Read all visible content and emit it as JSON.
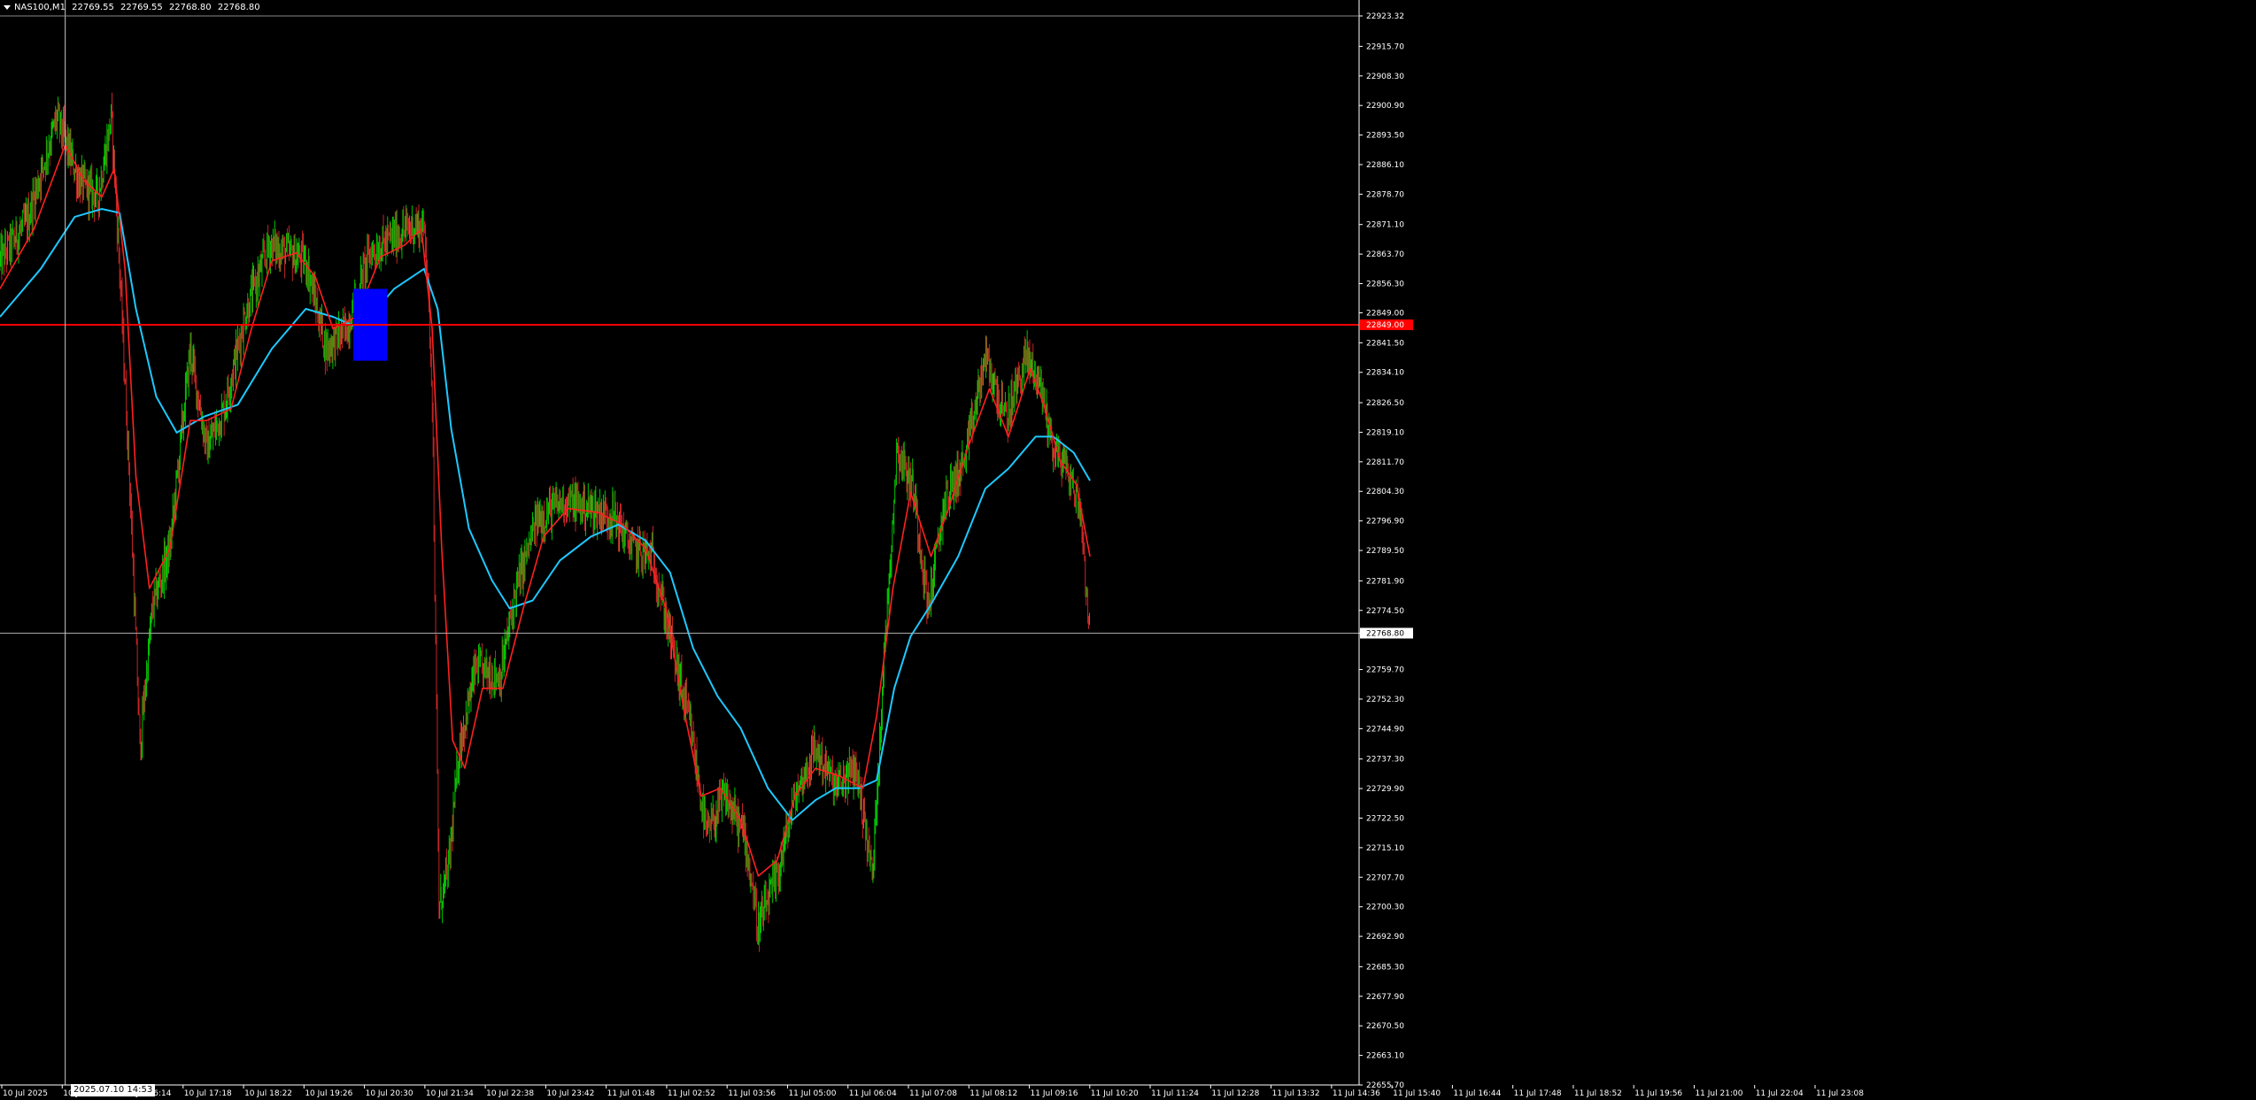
{
  "header": {
    "symbol": "NAS100,M1",
    "prices": [
      "22769.55",
      "22769.55",
      "22768.80",
      "22768.80"
    ]
  },
  "crosshair": {
    "time_label": "2025.07.10 14:53"
  },
  "colors": {
    "background": "#000000",
    "candle_up": "#00ff00",
    "candle_down": "#ff3030",
    "ma_fast": "#ff2020",
    "ma_slow": "#1ec8ff",
    "hline": "#ff0000",
    "box": "#0000ff",
    "axis_text": "#ffffff"
  },
  "icons": [
    "dropdown-triangle-icon"
  ],
  "chart_data": {
    "type": "line",
    "title": "NAS100,M1",
    "x_tick_labels": [
      "10 Jul 2025",
      "10 Jul 15:10",
      "10 Jul 16:14",
      "10 Jul 17:18",
      "10 Jul 18:22",
      "10 Jul 19:26",
      "10 Jul 20:30",
      "10 Jul 21:34",
      "10 Jul 22:38",
      "10 Jul 23:42",
      "11 Jul 01:48",
      "11 Jul 02:52",
      "11 Jul 03:56",
      "11 Jul 05:00",
      "11 Jul 06:04",
      "11 Jul 07:08",
      "11 Jul 08:12",
      "11 Jul 09:16",
      "11 Jul 10:20",
      "11 Jul 11:24",
      "11 Jul 12:28",
      "11 Jul 13:32",
      "11 Jul 14:36",
      "11 Jul 15:40",
      "11 Jul 16:44",
      "11 Jul 17:48",
      "11 Jul 18:52",
      "11 Jul 19:56",
      "11 Jul 21:00",
      "11 Jul 22:04",
      "11 Jul 23:08"
    ],
    "y_tick_labels": [
      "22923.32",
      "22915.70",
      "22908.30",
      "22900.90",
      "22893.50",
      "22886.10",
      "22878.70",
      "22871.10",
      "22863.70",
      "22856.30",
      "22849.00",
      "22841.50",
      "22834.10",
      "22826.50",
      "22819.10",
      "22811.70",
      "22804.30",
      "22796.90",
      "22789.50",
      "22781.90",
      "22774.50",
      "22768.80",
      "22759.70",
      "22752.30",
      "22744.90",
      "22737.30",
      "22729.90",
      "22722.50",
      "22715.10",
      "22707.70",
      "22700.30",
      "22692.90",
      "22685.30",
      "22677.90",
      "22670.50",
      "22663.10",
      "22655.70"
    ],
    "ylim": [
      22655.7,
      22923.32
    ],
    "horizontal_lines": [
      {
        "value": 22846.0,
        "label": "22849.00",
        "color": "#ff0000"
      },
      {
        "value": 22768.8,
        "label": "22768.80",
        "color": "#aaaaaa"
      }
    ],
    "x_domain": [
      0,
      1000
    ],
    "price_path_anchor_points": [
      {
        "x": 0,
        "y": 22862
      },
      {
        "x": 20,
        "y": 22872
      },
      {
        "x": 42,
        "y": 22898
      },
      {
        "x": 58,
        "y": 22882
      },
      {
        "x": 72,
        "y": 22878
      },
      {
        "x": 82,
        "y": 22898
      },
      {
        "x": 88,
        "y": 22860
      },
      {
        "x": 95,
        "y": 22810
      },
      {
        "x": 103,
        "y": 22740
      },
      {
        "x": 112,
        "y": 22775
      },
      {
        "x": 125,
        "y": 22790
      },
      {
        "x": 140,
        "y": 22840
      },
      {
        "x": 152,
        "y": 22815
      },
      {
        "x": 165,
        "y": 22825
      },
      {
        "x": 180,
        "y": 22848
      },
      {
        "x": 198,
        "y": 22866
      },
      {
        "x": 212,
        "y": 22864
      },
      {
        "x": 225,
        "y": 22862
      },
      {
        "x": 240,
        "y": 22840
      },
      {
        "x": 255,
        "y": 22845
      },
      {
        "x": 272,
        "y": 22864
      },
      {
        "x": 290,
        "y": 22868
      },
      {
        "x": 305,
        "y": 22871
      },
      {
        "x": 313,
        "y": 22870
      },
      {
        "x": 318,
        "y": 22830
      },
      {
        "x": 323,
        "y": 22700
      },
      {
        "x": 330,
        "y": 22710
      },
      {
        "x": 338,
        "y": 22740
      },
      {
        "x": 350,
        "y": 22760
      },
      {
        "x": 368,
        "y": 22758
      },
      {
        "x": 380,
        "y": 22780
      },
      {
        "x": 395,
        "y": 22797
      },
      {
        "x": 415,
        "y": 22802
      },
      {
        "x": 435,
        "y": 22800
      },
      {
        "x": 452,
        "y": 22798
      },
      {
        "x": 465,
        "y": 22790
      },
      {
        "x": 480,
        "y": 22788
      },
      {
        "x": 495,
        "y": 22765
      },
      {
        "x": 508,
        "y": 22745
      },
      {
        "x": 520,
        "y": 22718
      },
      {
        "x": 533,
        "y": 22728
      },
      {
        "x": 548,
        "y": 22718
      },
      {
        "x": 558,
        "y": 22695
      },
      {
        "x": 572,
        "y": 22708
      },
      {
        "x": 585,
        "y": 22728
      },
      {
        "x": 600,
        "y": 22740
      },
      {
        "x": 615,
        "y": 22730
      },
      {
        "x": 630,
        "y": 22735
      },
      {
        "x": 642,
        "y": 22708
      },
      {
        "x": 650,
        "y": 22760
      },
      {
        "x": 660,
        "y": 22815
      },
      {
        "x": 672,
        "y": 22805
      },
      {
        "x": 683,
        "y": 22775
      },
      {
        "x": 695,
        "y": 22802
      },
      {
        "x": 710,
        "y": 22812
      },
      {
        "x": 725,
        "y": 22838
      },
      {
        "x": 740,
        "y": 22822
      },
      {
        "x": 755,
        "y": 22838
      },
      {
        "x": 765,
        "y": 22832
      },
      {
        "x": 775,
        "y": 22815
      },
      {
        "x": 785,
        "y": 22810
      },
      {
        "x": 795,
        "y": 22800
      },
      {
        "x": 802,
        "y": 22768
      }
    ],
    "ma_fast_points": [
      {
        "x": 0,
        "y": 22855
      },
      {
        "x": 25,
        "y": 22870
      },
      {
        "x": 48,
        "y": 22891
      },
      {
        "x": 62,
        "y": 22882
      },
      {
        "x": 75,
        "y": 22878
      },
      {
        "x": 84,
        "y": 22885
      },
      {
        "x": 92,
        "y": 22860
      },
      {
        "x": 100,
        "y": 22808
      },
      {
        "x": 110,
        "y": 22780
      },
      {
        "x": 125,
        "y": 22790
      },
      {
        "x": 140,
        "y": 22822
      },
      {
        "x": 152,
        "y": 22822
      },
      {
        "x": 170,
        "y": 22825
      },
      {
        "x": 185,
        "y": 22845
      },
      {
        "x": 200,
        "y": 22862
      },
      {
        "x": 218,
        "y": 22864
      },
      {
        "x": 232,
        "y": 22858
      },
      {
        "x": 245,
        "y": 22845
      },
      {
        "x": 262,
        "y": 22848
      },
      {
        "x": 280,
        "y": 22863
      },
      {
        "x": 298,
        "y": 22866
      },
      {
        "x": 310,
        "y": 22870
      },
      {
        "x": 318,
        "y": 22845
      },
      {
        "x": 325,
        "y": 22790
      },
      {
        "x": 333,
        "y": 22742
      },
      {
        "x": 342,
        "y": 22735
      },
      {
        "x": 355,
        "y": 22755
      },
      {
        "x": 370,
        "y": 22755
      },
      {
        "x": 385,
        "y": 22775
      },
      {
        "x": 400,
        "y": 22793
      },
      {
        "x": 418,
        "y": 22800
      },
      {
        "x": 440,
        "y": 22799
      },
      {
        "x": 458,
        "y": 22796
      },
      {
        "x": 475,
        "y": 22790
      },
      {
        "x": 490,
        "y": 22775
      },
      {
        "x": 503,
        "y": 22750
      },
      {
        "x": 516,
        "y": 22728
      },
      {
        "x": 530,
        "y": 22730
      },
      {
        "x": 545,
        "y": 22722
      },
      {
        "x": 558,
        "y": 22708
      },
      {
        "x": 572,
        "y": 22712
      },
      {
        "x": 585,
        "y": 22728
      },
      {
        "x": 600,
        "y": 22735
      },
      {
        "x": 618,
        "y": 22733
      },
      {
        "x": 635,
        "y": 22730
      },
      {
        "x": 645,
        "y": 22748
      },
      {
        "x": 657,
        "y": 22780
      },
      {
        "x": 670,
        "y": 22804
      },
      {
        "x": 685,
        "y": 22788
      },
      {
        "x": 698,
        "y": 22800
      },
      {
        "x": 712,
        "y": 22815
      },
      {
        "x": 728,
        "y": 22830
      },
      {
        "x": 742,
        "y": 22818
      },
      {
        "x": 758,
        "y": 22835
      },
      {
        "x": 768,
        "y": 22826
      },
      {
        "x": 780,
        "y": 22812
      },
      {
        "x": 792,
        "y": 22806
      },
      {
        "x": 802,
        "y": 22788
      }
    ],
    "ma_slow_points": [
      {
        "x": 0,
        "y": 22848
      },
      {
        "x": 30,
        "y": 22860
      },
      {
        "x": 55,
        "y": 22873
      },
      {
        "x": 75,
        "y": 22875
      },
      {
        "x": 88,
        "y": 22874
      },
      {
        "x": 100,
        "y": 22850
      },
      {
        "x": 115,
        "y": 22828
      },
      {
        "x": 130,
        "y": 22819
      },
      {
        "x": 150,
        "y": 22823
      },
      {
        "x": 175,
        "y": 22826
      },
      {
        "x": 200,
        "y": 22840
      },
      {
        "x": 225,
        "y": 22850
      },
      {
        "x": 245,
        "y": 22848
      },
      {
        "x": 265,
        "y": 22845
      },
      {
        "x": 290,
        "y": 22855
      },
      {
        "x": 312,
        "y": 22860
      },
      {
        "x": 322,
        "y": 22850
      },
      {
        "x": 332,
        "y": 22820
      },
      {
        "x": 345,
        "y": 22795
      },
      {
        "x": 362,
        "y": 22782
      },
      {
        "x": 375,
        "y": 22775
      },
      {
        "x": 392,
        "y": 22777
      },
      {
        "x": 412,
        "y": 22787
      },
      {
        "x": 435,
        "y": 22793
      },
      {
        "x": 455,
        "y": 22796
      },
      {
        "x": 475,
        "y": 22792
      },
      {
        "x": 493,
        "y": 22784
      },
      {
        "x": 510,
        "y": 22765
      },
      {
        "x": 528,
        "y": 22753
      },
      {
        "x": 545,
        "y": 22745
      },
      {
        "x": 565,
        "y": 22730
      },
      {
        "x": 583,
        "y": 22722
      },
      {
        "x": 600,
        "y": 22727
      },
      {
        "x": 615,
        "y": 22730
      },
      {
        "x": 632,
        "y": 22730
      },
      {
        "x": 645,
        "y": 22732
      },
      {
        "x": 658,
        "y": 22755
      },
      {
        "x": 670,
        "y": 22768
      },
      {
        "x": 685,
        "y": 22776
      },
      {
        "x": 705,
        "y": 22788
      },
      {
        "x": 725,
        "y": 22805
      },
      {
        "x": 742,
        "y": 22810
      },
      {
        "x": 762,
        "y": 22818
      },
      {
        "x": 775,
        "y": 22818
      },
      {
        "x": 790,
        "y": 22814
      },
      {
        "x": 802,
        "y": 22807
      }
    ],
    "crosshair_x": 48,
    "blue_box": {
      "x0": 260,
      "x1": 285,
      "y0": 22837,
      "y1": 22855
    },
    "grid": false,
    "legend": "none"
  }
}
